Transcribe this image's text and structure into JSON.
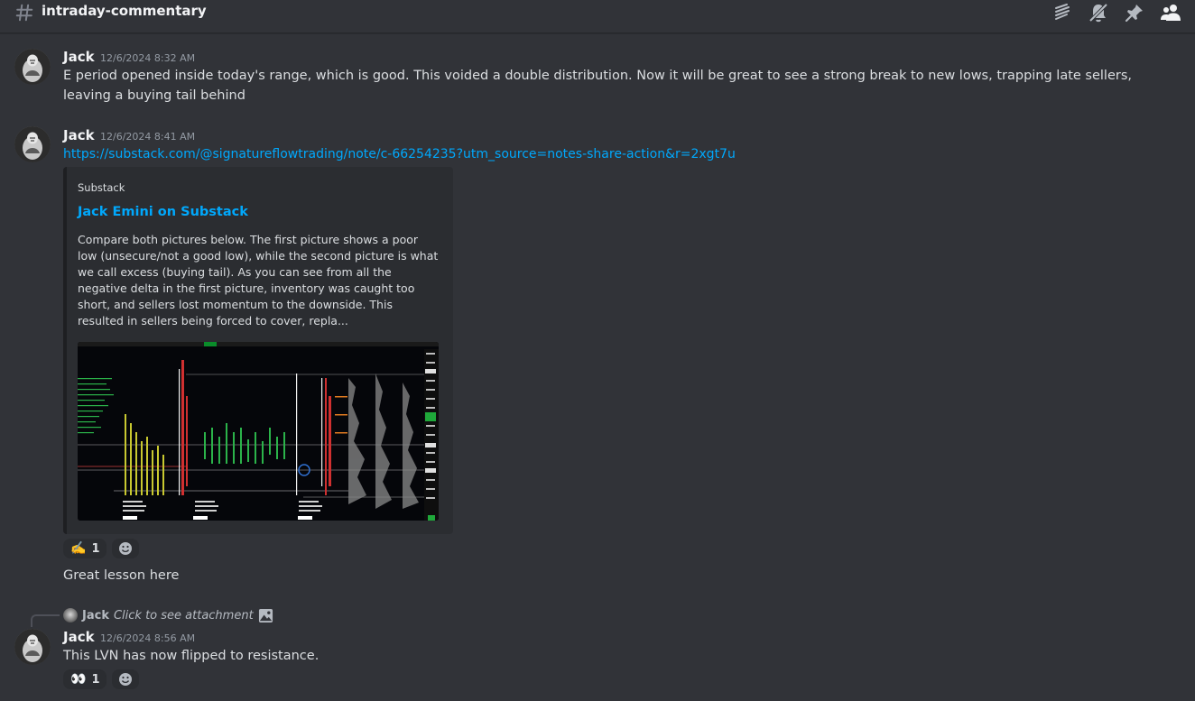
{
  "channel": {
    "name": "intraday-commentary",
    "icons": [
      "hash-icon",
      "threads-icon",
      "mute-icon",
      "pin-icon",
      "members-icon"
    ]
  },
  "messages": [
    {
      "author": "Jack",
      "timestamp": "12/6/2024 8:32 AM",
      "content": "E period opened inside today's range, which is good. This voided a double distribution. Now it will be great to see a strong break to new lows, trapping late sellers, leaving a buying tail behind"
    },
    {
      "author": "Jack",
      "timestamp": "12/6/2024 8:41 AM",
      "link": "https://substack.com/@signatureflowtrading/note/c-66254235?utm_source=notes-share-action&r=2xgt7u",
      "embed": {
        "provider": "Substack",
        "title": "Jack Emini on Substack",
        "description": "Compare both pictures below. The first picture shows a poor low (unsecure/not a good low), while the second picture is what we call excess (buying tail). As you can see from all the negative delta in the first picture, inventory was caught too short, and sellers lost momentum to the downside. This resulted in sellers being forced to cover, repla..."
      },
      "reactions": [
        {
          "emoji": "✍️",
          "count": "1"
        }
      ],
      "followup": "Great lesson here"
    },
    {
      "reply": {
        "author": "Jack",
        "text": "Click to see attachment"
      },
      "author": "Jack",
      "timestamp": "12/6/2024 8:56 AM",
      "content": "This LVN has now flipped to resistance.",
      "reactions": [
        {
          "emoji": "👀",
          "count": "1"
        }
      ]
    }
  ]
}
